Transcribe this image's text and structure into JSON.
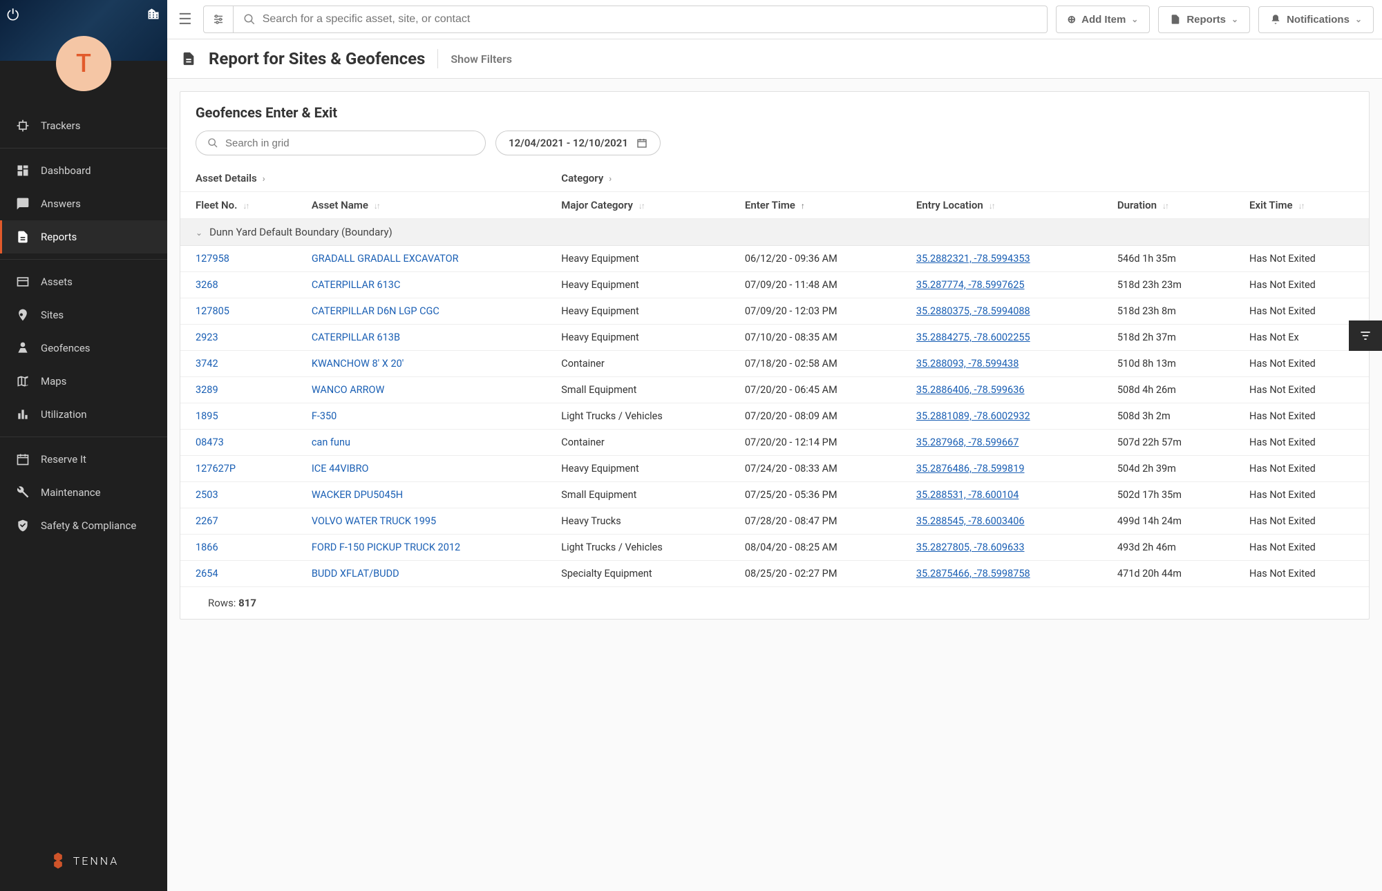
{
  "avatar_letter": "T",
  "brand": "TENNA",
  "nav": {
    "trackers": "Trackers",
    "dashboard": "Dashboard",
    "answers": "Answers",
    "reports": "Reports",
    "assets": "Assets",
    "sites": "Sites",
    "geofences": "Geofences",
    "maps": "Maps",
    "utilization": "Utilization",
    "reserveit": "Reserve It",
    "maintenance": "Maintenance",
    "safety": "Safety & Compliance"
  },
  "topbar": {
    "search_placeholder": "Search for a specific asset, site, or contact",
    "add_item": "Add Item",
    "reports": "Reports",
    "notifications": "Notifications"
  },
  "titlebar": {
    "title": "Report for Sites & Geofences",
    "show_filters": "Show Filters"
  },
  "panel": {
    "title": "Geofences Enter & Exit",
    "grid_search_placeholder": "Search in grid",
    "date_range": "12/04/2021 - 12/10/2021"
  },
  "headers": {
    "asset_details": "Asset Details",
    "category": "Category",
    "fleet_no": "Fleet No.",
    "asset_name": "Asset Name",
    "major_category": "Major Category",
    "enter_time": "Enter Time",
    "entry_location": "Entry Location",
    "duration": "Duration",
    "exit_time": "Exit Time"
  },
  "group_label": "Dunn Yard Default Boundary (Boundary)",
  "rows": [
    {
      "fleet": "127958",
      "name": "GRADALL GRADALL EXCAVATOR",
      "cat": "Heavy Equipment",
      "enter": "06/12/20 - 09:36 AM",
      "loc": "35.2882321, -78.5994353",
      "dur": "546d 1h 35m",
      "exit": "Has Not Exited"
    },
    {
      "fleet": "3268",
      "name": "CATERPILLAR 613C",
      "cat": "Heavy Equipment",
      "enter": "07/09/20 - 11:48 AM",
      "loc": "35.287774, -78.5997625",
      "dur": "518d 23h 23m",
      "exit": "Has Not Exited"
    },
    {
      "fleet": "127805",
      "name": "CATERPILLAR D6N LGP CGC",
      "cat": "Heavy Equipment",
      "enter": "07/09/20 - 12:03 PM",
      "loc": "35.2880375, -78.5994088",
      "dur": "518d 23h 8m",
      "exit": "Has Not Exited"
    },
    {
      "fleet": "2923",
      "name": "CATERPILLAR 613B",
      "cat": "Heavy Equipment",
      "enter": "07/10/20 - 08:35 AM",
      "loc": "35.2884275, -78.6002255",
      "dur": "518d 2h 37m",
      "exit": "Has Not Ex"
    },
    {
      "fleet": "3742",
      "name": "KWANCHOW 8' X 20'",
      "cat": "Container",
      "enter": "07/18/20 - 02:58 AM",
      "loc": "35.288093, -78.599438",
      "dur": "510d 8h 13m",
      "exit": "Has Not Exited"
    },
    {
      "fleet": "3289",
      "name": "WANCO ARROW",
      "cat": "Small Equipment",
      "enter": "07/20/20 - 06:45 AM",
      "loc": "35.2886406, -78.599636",
      "dur": "508d 4h 26m",
      "exit": "Has Not Exited"
    },
    {
      "fleet": "1895",
      "name": "F-350",
      "cat": "Light Trucks / Vehicles",
      "enter": "07/20/20 - 08:09 AM",
      "loc": "35.2881089, -78.6002932",
      "dur": "508d 3h 2m",
      "exit": "Has Not Exited"
    },
    {
      "fleet": "08473",
      "name": "can funu",
      "cat": "Container",
      "enter": "07/20/20 - 12:14 PM",
      "loc": "35.287968, -78.599667",
      "dur": "507d 22h 57m",
      "exit": "Has Not Exited"
    },
    {
      "fleet": "127627P",
      "name": "ICE 44VIBRO",
      "cat": "Heavy Equipment",
      "enter": "07/24/20 - 08:33 AM",
      "loc": "35.2876486, -78.599819",
      "dur": "504d 2h 39m",
      "exit": "Has Not Exited"
    },
    {
      "fleet": "2503",
      "name": "WACKER DPU5045H",
      "cat": "Small Equipment",
      "enter": "07/25/20 - 05:36 PM",
      "loc": "35.288531, -78.600104",
      "dur": "502d 17h 35m",
      "exit": "Has Not Exited"
    },
    {
      "fleet": "2267",
      "name": "VOLVO WATER TRUCK 1995",
      "cat": "Heavy Trucks",
      "enter": "07/28/20 - 08:47 PM",
      "loc": "35.288545, -78.6003406",
      "dur": "499d 14h 24m",
      "exit": "Has Not Exited"
    },
    {
      "fleet": "1866",
      "name": "FORD F-150 PICKUP TRUCK 2012",
      "cat": "Light Trucks / Vehicles",
      "enter": "08/04/20 - 08:25 AM",
      "loc": "35.2827805, -78.609633",
      "dur": "493d 2h 46m",
      "exit": "Has Not Exited"
    },
    {
      "fleet": "2654",
      "name": "BUDD XFLAT/BUDD",
      "cat": "Specialty Equipment",
      "enter": "08/25/20 - 02:27 PM",
      "loc": "35.2875466, -78.5998758",
      "dur": "471d 20h 44m",
      "exit": "Has Not Exited"
    }
  ],
  "rows_label": "Rows: ",
  "rows_count": "817"
}
